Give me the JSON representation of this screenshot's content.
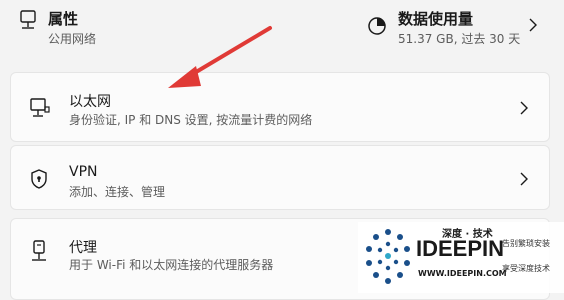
{
  "properties": {
    "title": "属性",
    "subtitle": "公用网络"
  },
  "data_usage": {
    "title": "数据使用量",
    "subtitle": "51.37 GB, 过去 30 天"
  },
  "items": [
    {
      "title": "以太网",
      "subtitle": "身份验证, IP 和 DNS 设置, 按流量计费的网络",
      "icon": "ethernet-icon"
    },
    {
      "title": "VPN",
      "subtitle": "添加、连接、管理",
      "icon": "shield-icon"
    },
    {
      "title": "代理",
      "subtitle": "用于 Wi-Fi 和以太网连接的代理服务器",
      "icon": "proxy-icon"
    }
  ],
  "watermark": {
    "tagline": "深度 · 技术",
    "brand": "IDEEPIN",
    "url": "WWW.IDEEPIN.COM",
    "slogan1": "告别繁琐安装",
    "slogan2": "享受深度技术"
  },
  "colors": {
    "arrow": "#e03a36",
    "accent_blue": "#1a4f8a"
  }
}
